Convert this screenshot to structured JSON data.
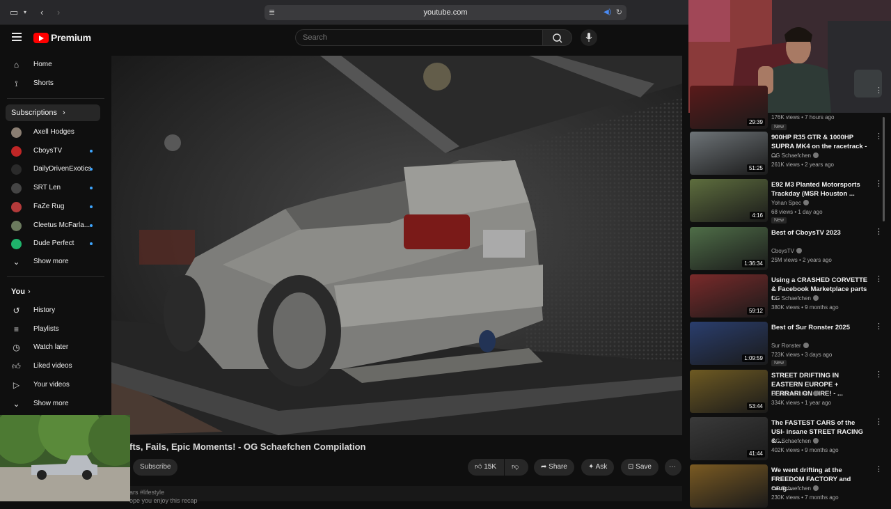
{
  "browser": {
    "url": "youtube.com"
  },
  "header": {
    "logo_text": "Premium",
    "search_placeholder": "Search"
  },
  "sidebar": {
    "top": [
      {
        "label": "Home",
        "icon": "home-icon"
      },
      {
        "label": "Shorts",
        "icon": "shorts-icon"
      }
    ],
    "subscriptions_label": "Subscriptions",
    "subscriptions": [
      {
        "label": "Axell Hodges",
        "dot": false,
        "color": "#8a7e72"
      },
      {
        "label": "CboysTV",
        "dot": true,
        "color": "#c02626"
      },
      {
        "label": "DailyDrivenExotics",
        "dot": true,
        "color": "#2a2a2a"
      },
      {
        "label": "SRT Len",
        "dot": true,
        "color": "#444444"
      },
      {
        "label": "FaZe Rug",
        "dot": true,
        "color": "#b33a3a"
      },
      {
        "label": "Cleetus McFarla...",
        "dot": true,
        "color": "#6b7a5e"
      },
      {
        "label": "Dude Perfect",
        "dot": true,
        "color": "#1fb36b"
      }
    ],
    "show_more": "Show more",
    "you_label": "You",
    "you_items": [
      {
        "label": "History",
        "icon": "history-icon"
      },
      {
        "label": "Playlists",
        "icon": "playlists-icon"
      },
      {
        "label": "Watch later",
        "icon": "watch-later-icon"
      },
      {
        "label": "Liked videos",
        "icon": "liked-videos-icon"
      },
      {
        "label": "Your videos",
        "icon": "your-videos-icon"
      }
    ],
    "show_more_2": "Show more"
  },
  "video": {
    "title": "fts, Fails, Epic Moments! - OG Schaefchen Compilation",
    "subscribe": "Subscribe",
    "likes": "15K",
    "share": "Share",
    "ask": "Ask",
    "save": "Save",
    "desc_line1": "ars #lifestyle",
    "desc_line2": "ope you enjoy this recap"
  },
  "recommendations": [
    {
      "title": "",
      "channel": "",
      "meta": "176K views • 7 hours ago",
      "duration": "29:39",
      "new": true,
      "color": "#5a1a1a"
    },
    {
      "title": "900HP R35 GTR & 1000HP SUPRA MK4 on the racetrack - ...",
      "channel": "OG Schaefchen",
      "meta": "261K views • 2 years ago",
      "duration": "51:25",
      "new": false,
      "color": "#6e7478"
    },
    {
      "title": "E92 M3 Planted Motorsports Trackday (MSR Houston ...",
      "channel": "Yohan Spec",
      "meta": "68 views • 1 day ago",
      "duration": "4:16",
      "new": true,
      "color": "#5e6e3e"
    },
    {
      "title": "Best of CboysTV 2023",
      "channel": "CboysTV",
      "meta": "25M views • 2 years ago",
      "duration": "1:36:34",
      "new": false,
      "color": "#4f6e48"
    },
    {
      "title": "Using a CRASHED CORVETTE & Facebook Marketplace parts t...",
      "channel": "OG Schaefchen",
      "meta": "380K views • 9 months ago",
      "duration": "59:12",
      "new": false,
      "color": "#7a2a2a"
    },
    {
      "title": "Best of Sur Ronster 2025",
      "channel": "Sur Ronster",
      "meta": "723K views • 3 days ago",
      "duration": "1:09:59",
      "new": true,
      "color": "#2a3e6e"
    },
    {
      "title": "STREET DRIFTING IN EASTERN EUROPE + FERRARI ON FIRE! - ...",
      "channel": "OG Schaefchen",
      "meta": "334K views • 1 year ago",
      "duration": "53:44",
      "new": false,
      "color": "#6e5a22"
    },
    {
      "title": "The FASTEST CARS of the USI- insane STREET RACING & ...",
      "channel": "OG Schaefchen",
      "meta": "402K views • 9 months ago",
      "duration": "41:44",
      "new": false,
      "color": "#3a3a3a"
    },
    {
      "title": "We went drifting at the FREEDOM FACTORY and caug...",
      "channel": "OG Schaefchen",
      "meta": "230K views • 7 months ago",
      "duration": "",
      "new": false,
      "color": "#7a5a22"
    }
  ]
}
